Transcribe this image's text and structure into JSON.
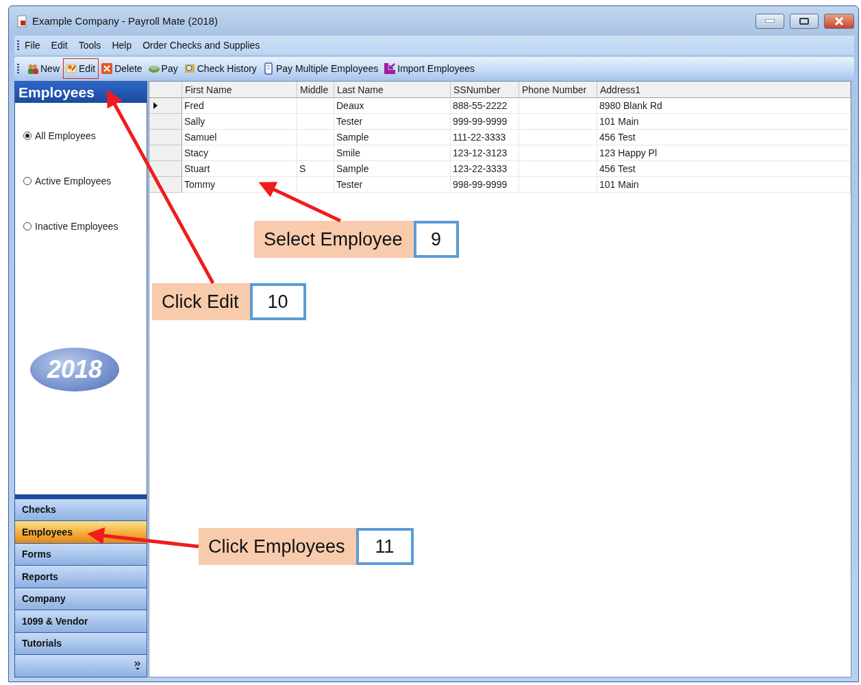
{
  "window": {
    "title": "Example Company - Payroll Mate (2018)"
  },
  "menu": [
    "File",
    "Edit",
    "Tools",
    "Help",
    "Order Checks and Supplies"
  ],
  "toolbar": [
    {
      "label": "New",
      "kind": "new",
      "highlighted": false
    },
    {
      "label": "Edit",
      "kind": "edit",
      "highlighted": true
    },
    {
      "label": "Delete",
      "kind": "delete",
      "highlighted": false
    },
    {
      "label": "Pay",
      "kind": "pay",
      "highlighted": false
    },
    {
      "label": "Check History",
      "kind": "history",
      "highlighted": false
    },
    {
      "label": "Pay Multiple Employees",
      "kind": "multi",
      "highlighted": false
    },
    {
      "label": "Import Employees",
      "kind": "import",
      "highlighted": false
    }
  ],
  "sidebar": {
    "title": "Employees",
    "filters": [
      {
        "label": "All Employees",
        "selected": true
      },
      {
        "label": "Active Employees",
        "selected": false
      },
      {
        "label": "Inactive Employees",
        "selected": false
      }
    ],
    "logo": "2018",
    "nav": [
      {
        "label": "Checks",
        "selected": false
      },
      {
        "label": "Employees",
        "selected": true
      },
      {
        "label": "Forms",
        "selected": false
      },
      {
        "label": "Reports",
        "selected": false
      },
      {
        "label": "Company",
        "selected": false
      },
      {
        "label": "1099 & Vendor",
        "selected": false
      },
      {
        "label": "Tutorials",
        "selected": false
      }
    ]
  },
  "table": {
    "columns": [
      "First Name",
      "Middle",
      "Last Name",
      "SSNumber",
      "Phone Number",
      "Address1"
    ],
    "rows": [
      {
        "cells": [
          "Fred",
          "",
          "Deaux",
          "888-55-2222",
          "",
          "8980 Blank Rd"
        ],
        "selected": true
      },
      {
        "cells": [
          "Sally",
          "",
          "Tester",
          "999-99-9999",
          "",
          "101 Main"
        ],
        "selected": false
      },
      {
        "cells": [
          "Samuel",
          "",
          "Sample",
          "111-22-3333",
          "",
          "456 Test"
        ],
        "selected": false
      },
      {
        "cells": [
          "Stacy",
          "",
          "Smile",
          "123-12-3123",
          "",
          "123 Happy Pl"
        ],
        "selected": false
      },
      {
        "cells": [
          "Stuart",
          "S",
          "Sample",
          "123-22-3333",
          "",
          "456 Test"
        ],
        "selected": false
      },
      {
        "cells": [
          "Tommy",
          "",
          "Tester",
          "998-99-9999",
          "",
          "101 Main"
        ],
        "selected": false
      }
    ]
  },
  "annotations": [
    {
      "text": "Select Employee",
      "number": "9"
    },
    {
      "text": "Click Edit",
      "number": "10"
    },
    {
      "text": "Click Employees",
      "number": "11"
    }
  ]
}
